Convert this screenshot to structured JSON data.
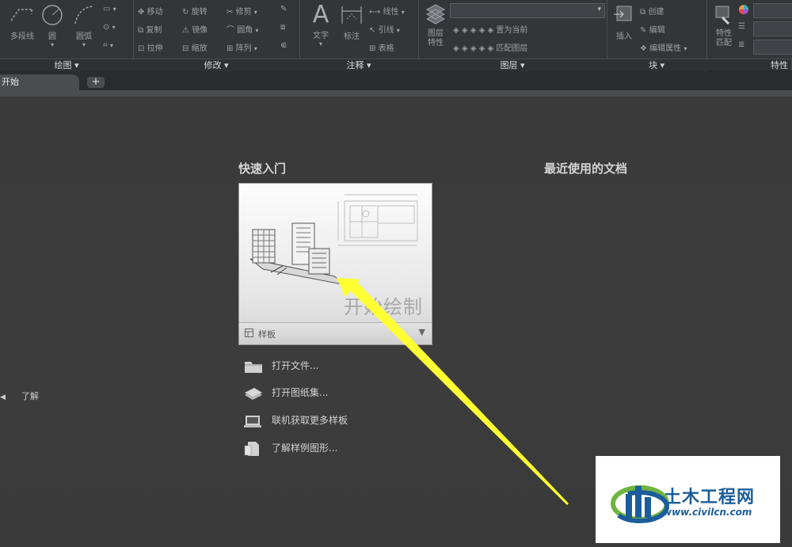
{
  "ribbon": {
    "panels": {
      "draw": "绘图",
      "modify": "修改",
      "annotate": "注释",
      "layers": "图层",
      "block": "块",
      "properties": "特性"
    },
    "draw_tools": {
      "polyline": "多段线",
      "circle": "圆",
      "arc": "圆弧"
    },
    "modify_tools": {
      "move": "移动",
      "rotate": "旋转",
      "trim": "修剪",
      "copy": "复制",
      "mirror": "镜像",
      "fillet": "圆角",
      "stretch": "拉伸",
      "scale": "缩放",
      "array": "阵列"
    },
    "annotate_tools": {
      "text": "文字",
      "dimension": "标注",
      "linear": "线性",
      "leader": "引线",
      "table": "表格"
    },
    "layer_tools": {
      "layer_properties": "图层\n特性",
      "set_current": "置为当前",
      "match_layer": "匹配图层"
    },
    "block_tools": {
      "insert": "插入",
      "create": "创建",
      "edit": "编辑",
      "edit_attributes": "编辑属性"
    },
    "properties_tools": {
      "match_properties": "特性\n匹配"
    }
  },
  "tabs": {
    "start": "开始",
    "add": "+"
  },
  "main": {
    "quick_start": "快速入门",
    "recent_docs": "最近使用的文档",
    "start_drawing": "开始绘制",
    "template": "样板",
    "learn": "了解",
    "links": [
      {
        "label": "打开文件..."
      },
      {
        "label": "打开图纸集..."
      },
      {
        "label": "联机获取更多样板"
      },
      {
        "label": "了解样例图形..."
      }
    ]
  },
  "watermark": {
    "title": "土木工程网",
    "url": "www.civilcn.com"
  },
  "colors": {
    "arrow": "#ffff33",
    "ribbon_bg": "#333639",
    "page_bg": "#3b3b3b",
    "brand_blue": "#1b5d9a",
    "brand_green": "#6fb43f"
  }
}
